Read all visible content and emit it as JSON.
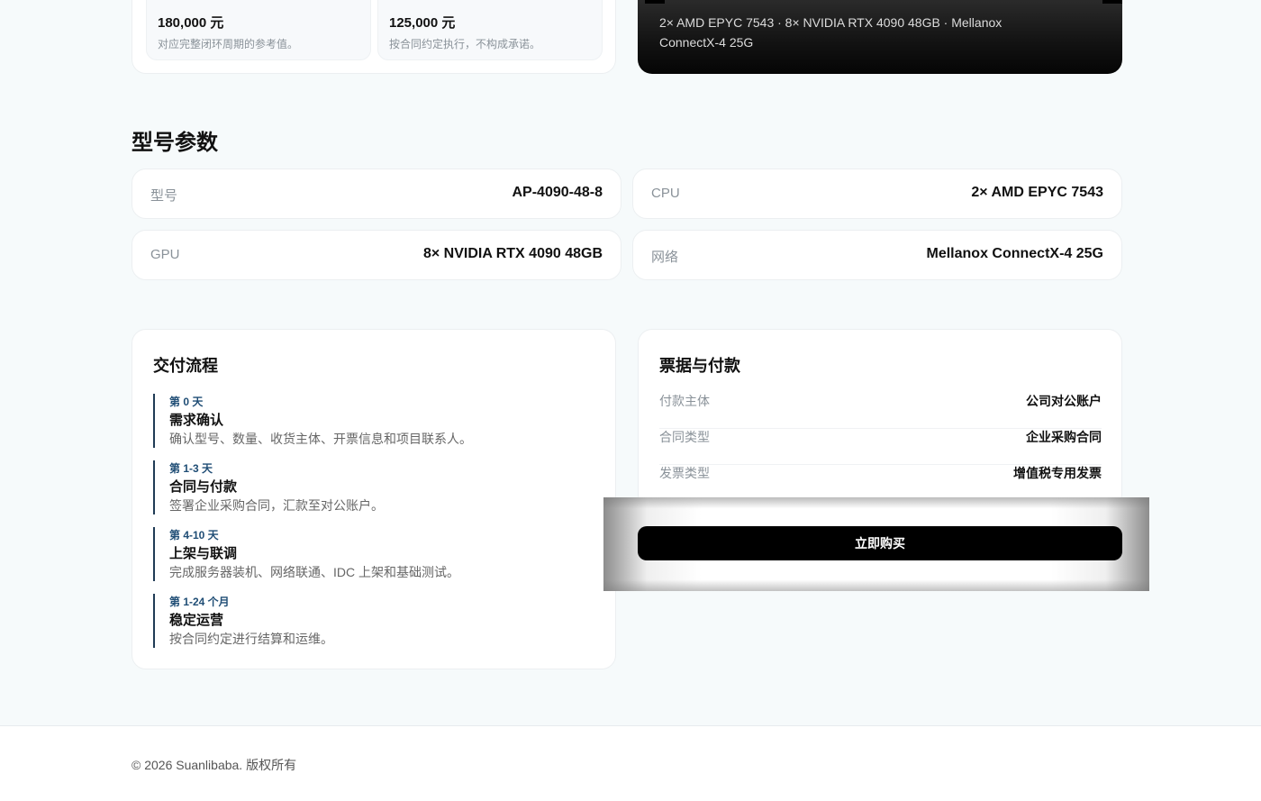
{
  "stats": [
    {
      "label": "",
      "value": "180,000 元",
      "note": "对应完整闭环周期的参考值。"
    },
    {
      "label": "",
      "value": "125,000 元",
      "note": "按合同约定执行，不构成承诺。"
    }
  ],
  "hero": {
    "title": "",
    "description": "2× AMD EPYC 7543 · 8× NVIDIA RTX 4090 48GB · Mellanox ConnectX-4 25G"
  },
  "specs": {
    "title": "型号参数",
    "items": [
      {
        "key": "型号",
        "value": "AP-4090-48-8"
      },
      {
        "key": "CPU",
        "value": "2× AMD EPYC 7543"
      },
      {
        "key": "GPU",
        "value": "8× NVIDIA RTX 4090 48GB"
      },
      {
        "key": "网络",
        "value": "Mellanox ConnectX-4 25G"
      }
    ]
  },
  "flow": {
    "title": "交付流程",
    "steps": [
      {
        "day": "第 0 天",
        "title": "需求确认",
        "desc": "确认型号、数量、收货主体、开票信息和项目联系人。"
      },
      {
        "day": "第 1-3 天",
        "title": "合同与付款",
        "desc": "签署企业采购合同，汇款至对公账户。"
      },
      {
        "day": "第 4-10 天",
        "title": "上架与联调",
        "desc": "完成服务器装机、网络联通、IDC 上架和基础测试。"
      },
      {
        "day": "第 1-24 个月",
        "title": "稳定运营",
        "desc": "按合同约定进行结算和运维。"
      }
    ]
  },
  "payment": {
    "title": "票据与付款",
    "rows": [
      {
        "key": "付款主体",
        "value": "公司对公账户"
      },
      {
        "key": "合同类型",
        "value": "企业采购合同"
      },
      {
        "key": "发票类型",
        "value": "增值税专用发票"
      }
    ],
    "buy_label": "立即购买"
  },
  "footer": {
    "copyright": "© 2026 Suanlibaba. 版权所有"
  }
}
